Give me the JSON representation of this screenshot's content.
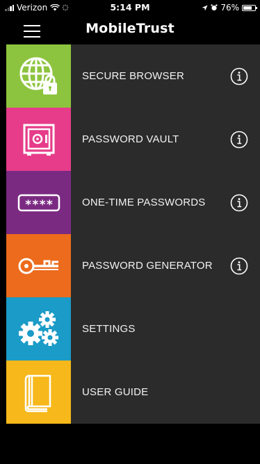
{
  "status_bar": {
    "carrier": "Verizon",
    "time": "5:14 PM",
    "battery": "76%",
    "battery_level": 0.76
  },
  "header": {
    "title": "MobileTrust"
  },
  "menu": {
    "items": [
      {
        "label": "SECURE BROWSER",
        "color": "#8dc43f",
        "icon": "globe-lock-icon",
        "has_info": true
      },
      {
        "label": "PASSWORD VAULT",
        "color": "#e63c8a",
        "icon": "safe-icon",
        "has_info": true
      },
      {
        "label": "ONE-TIME PASSWORDS",
        "color": "#7b2a82",
        "icon": "password-field-icon",
        "has_info": true
      },
      {
        "label": "PASSWORD GENERATOR",
        "color": "#ec6b1c",
        "icon": "key-icon",
        "has_info": true
      },
      {
        "label": "SETTINGS",
        "color": "#1b9bc7",
        "icon": "gears-icon",
        "has_info": false
      },
      {
        "label": "USER GUIDE",
        "color": "#f6b81a",
        "icon": "book-icon",
        "has_info": false
      }
    ]
  }
}
